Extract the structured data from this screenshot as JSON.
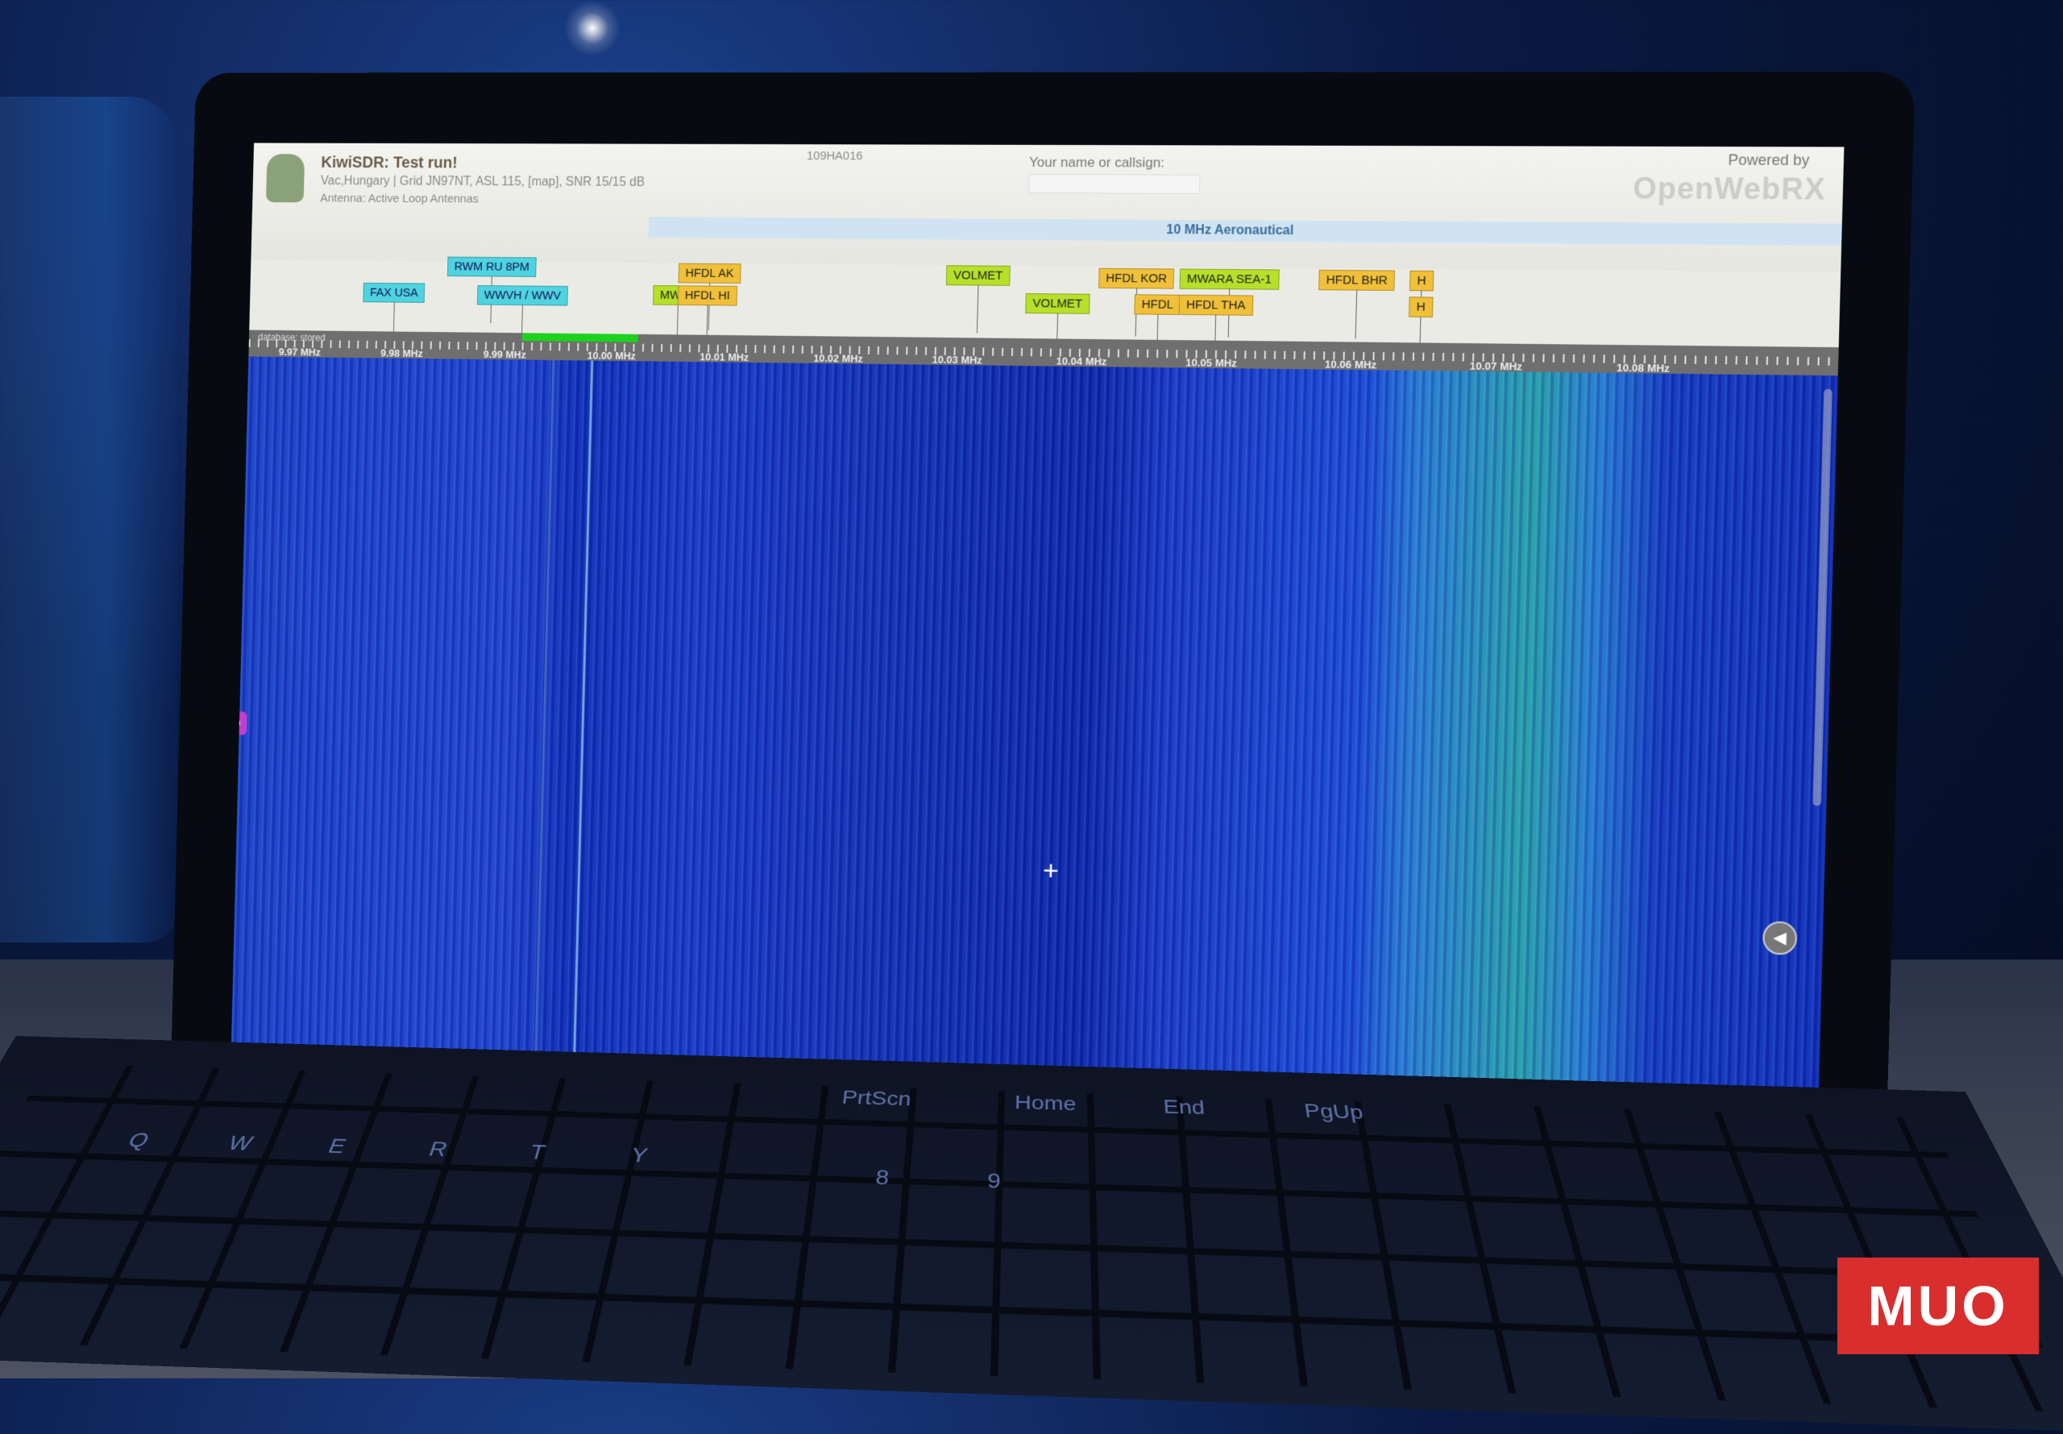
{
  "topbar": {
    "title": "KiwiSDR: Test run!",
    "location": "Vac,Hungary | Grid JN97NT, ASL 115, [map], SNR 15/15 dB",
    "antenna": "Antenna: Active Loop Antennas",
    "session_id": "109HA016",
    "callsign_label": "Your name or callsign:",
    "powered_by": "Powered by",
    "brand": "OpenWebRX"
  },
  "band_label": "10 MHz Aeronautical",
  "scale": {
    "database": "database: stored",
    "labels": [
      "9.97 MHz",
      "9.98 MHz",
      "9.99 MHz",
      "10.00 MHz",
      "10.01 MHz",
      "10.02 MHz",
      "10.03 MHz",
      "10.04 MHz",
      "10.05 MHz",
      "10.06 MHz",
      "10.07 MHz",
      "10.08 MHz"
    ]
  },
  "tags": [
    {
      "label": "FAX USA",
      "color": "cyan"
    },
    {
      "label": "RWM RU 8PM",
      "color": "cyan"
    },
    {
      "label": "WWVH / WWV",
      "color": "cyan"
    },
    {
      "label": "HFDL AK",
      "color": "yellow"
    },
    {
      "label": "MWAR",
      "color": "green"
    },
    {
      "label": "HFDL HI",
      "color": "yellow"
    },
    {
      "label": "VOLMET",
      "color": "green"
    },
    {
      "label": "HFDL KOR",
      "color": "yellow"
    },
    {
      "label": "MWARA SEA-1",
      "color": "green"
    },
    {
      "label": "HFDL BHR",
      "color": "yellow"
    },
    {
      "label": "VOLMET",
      "color": "green"
    },
    {
      "label": "HFDL",
      "color": "yellow"
    },
    {
      "label": "HFDL THA",
      "color": "yellow"
    },
    {
      "label": "H",
      "color": "yellow"
    },
    {
      "label": "H",
      "color": "yellow"
    }
  ],
  "keys": [
    "Q",
    "W",
    "E",
    "R",
    "T",
    "Y",
    "PrtScn",
    "Home",
    "End",
    "PgUp",
    "9",
    "8"
  ],
  "watermark": "MUO"
}
